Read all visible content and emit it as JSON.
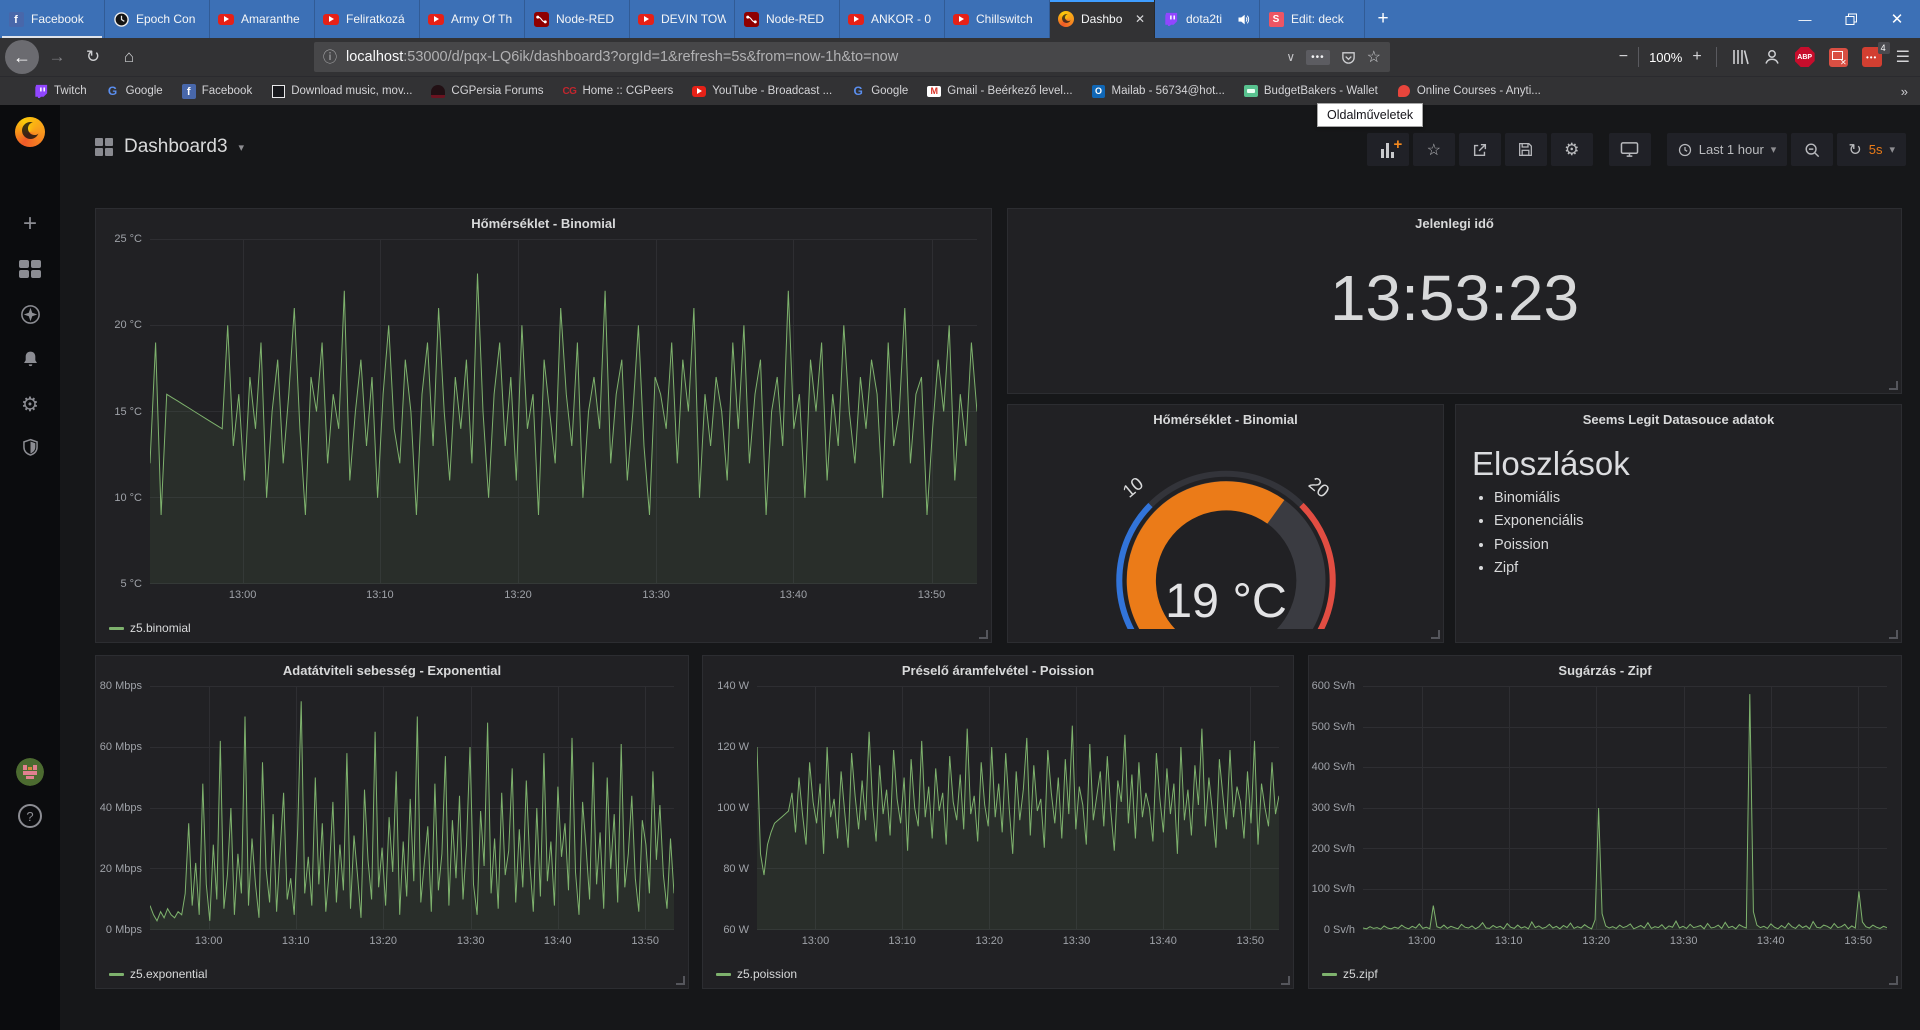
{
  "browser": {
    "tabs": [
      {
        "id": "facebook",
        "label": "Facebook",
        "icon": "facebook",
        "container": true
      },
      {
        "id": "epoch-converter",
        "label": "Epoch Con",
        "icon": "clock"
      },
      {
        "id": "amaranthe",
        "label": "Amaranthe",
        "icon": "youtube"
      },
      {
        "id": "feliratkozas",
        "label": "Feliratkozá",
        "icon": "youtube"
      },
      {
        "id": "army-of-the",
        "label": "Army Of Th",
        "icon": "youtube"
      },
      {
        "id": "node-red-1",
        "label": "Node-RED",
        "icon": "nodered"
      },
      {
        "id": "devin-townsend",
        "label": "DEVIN TOW",
        "icon": "youtube"
      },
      {
        "id": "node-red-2",
        "label": "Node-RED",
        "icon": "nodered"
      },
      {
        "id": "ankor",
        "label": "ANKOR - 0",
        "icon": "youtube"
      },
      {
        "id": "chillswitch",
        "label": "Chillswitch",
        "icon": "youtube"
      },
      {
        "id": "dashboard",
        "label": "Dashbo",
        "icon": "grafana",
        "active": true,
        "close": "✕"
      },
      {
        "id": "dota2ti",
        "label": "dota2ti",
        "icon": "twitch",
        "audio": true
      },
      {
        "id": "edit-deck",
        "label": "Edit: deck",
        "icon": "slides"
      }
    ],
    "new_tab_label": "+",
    "window_controls": {
      "minimize": "—",
      "close": "✕"
    },
    "nav": {
      "url_host": "localhost",
      "url_rest": ":53000/d/pqx-LQ6ik/dashboard3?orgId=1&refresh=5s&from=now-1h&to=now",
      "page_actions_glyph": "•••",
      "zoom_level": "100%",
      "extension_badge_count": "4",
      "abp_label": "ABP"
    },
    "bookmarks": [
      {
        "label": "Twitch",
        "icon": "twitch"
      },
      {
        "label": "Google",
        "icon": "google"
      },
      {
        "label": "Facebook",
        "icon": "facebook"
      },
      {
        "label": "Download music, mov...",
        "icon": "archive"
      },
      {
        "label": "CGPersia Forums",
        "icon": "cgpersia"
      },
      {
        "label": "Home :: CGPeers",
        "icon": "cgpeers"
      },
      {
        "label": "YouTube - Broadcast ...",
        "icon": "youtube"
      },
      {
        "label": "Google",
        "icon": "google"
      },
      {
        "label": "Gmail - Beérkező level...",
        "icon": "gmail"
      },
      {
        "label": "Mailab - 56734@hot...",
        "icon": "outlook"
      },
      {
        "label": "BudgetBakers - Wallet",
        "icon": "budgetbakers"
      },
      {
        "label": "Online Courses - Anyti...",
        "icon": "courses"
      }
    ],
    "bookmarks_overflow": "»",
    "tooltip": "Oldalműveletek"
  },
  "grafana": {
    "toolbar": {
      "title": "Dashboard3",
      "time_range": "Last 1 hour",
      "refresh_interval": "5s"
    },
    "clock_panel": {
      "title": "Jelenlegi idő",
      "time": "13:53:23"
    },
    "text_panel": {
      "title": "Seems Legit Datasouce adatok",
      "heading": "Eloszlások",
      "items": [
        "Binomiális",
        "Exponenciális",
        "Poission",
        "Zipf"
      ]
    }
  },
  "chart_data": [
    {
      "type": "line",
      "title": "Hőmérséklet - Binomial",
      "series_label": "z5.binomial",
      "color": "#7eb26d",
      "ylim": [
        5,
        25
      ],
      "yticks": [
        "25 °C",
        "20 °C",
        "15 °C",
        "10 °C",
        "5 °C"
      ],
      "xticks": [
        "13:00",
        "13:10",
        "13:20",
        "13:30",
        "13:40",
        "13:50"
      ],
      "xtick_fracs": [
        0.112,
        0.278,
        0.445,
        0.612,
        0.778,
        0.945
      ],
      "values": [
        12,
        19,
        9,
        16,
        15.8,
        15.6,
        15.4,
        15.2,
        15,
        14.8,
        14.6,
        14.4,
        14.2,
        14,
        20,
        13,
        16,
        11,
        17,
        14,
        19,
        10,
        15,
        18,
        12,
        16,
        21,
        14,
        9,
        17,
        15,
        19,
        12,
        16,
        14,
        22,
        11,
        15,
        18,
        13,
        17,
        10,
        16,
        20,
        14,
        12,
        18,
        15,
        9,
        16,
        19,
        13,
        21,
        15,
        11,
        17,
        14,
        18,
        12,
        23,
        15,
        10,
        16,
        19,
        13,
        17,
        11,
        20,
        14,
        16,
        9,
        18,
        15,
        12,
        21,
        16,
        13,
        19,
        10,
        15,
        17,
        14,
        22,
        12,
        16,
        18,
        11,
        15,
        20,
        13,
        9,
        17,
        16,
        14,
        19,
        12,
        18,
        15,
        21,
        10,
        16,
        13,
        17,
        15,
        11,
        19,
        14,
        20,
        12,
        16,
        18,
        9,
        15,
        17,
        13,
        22,
        14,
        16,
        10,
        18,
        15,
        19,
        11,
        16,
        13,
        20,
        15,
        12,
        17,
        14,
        18,
        16,
        10,
        19,
        13,
        15,
        21,
        12,
        16,
        17,
        9,
        14,
        18,
        15,
        20,
        11,
        16,
        13,
        19,
        15
      ]
    },
    {
      "type": "line",
      "title": "Adatátviteli sebesség - Exponential",
      "series_label": "z5.exponential",
      "color": "#7eb26d",
      "ylim": [
        0,
        80
      ],
      "yticks": [
        "80 Mbps",
        "60 Mbps",
        "40 Mbps",
        "20 Mbps",
        "0 Mbps"
      ],
      "xticks": [
        "13:00",
        "13:10",
        "13:20",
        "13:30",
        "13:40",
        "13:50"
      ],
      "xtick_fracs": [
        0.112,
        0.278,
        0.445,
        0.612,
        0.778,
        0.945
      ],
      "values": [
        8,
        5,
        3,
        6,
        4,
        7,
        5,
        4,
        6,
        5,
        12,
        35,
        8,
        22,
        5,
        48,
        15,
        3,
        28,
        10,
        62,
        7,
        18,
        40,
        5,
        25,
        12,
        70,
        8,
        30,
        15,
        4,
        55,
        20,
        9,
        38,
        6,
        26,
        45,
        10,
        17,
        5,
        33,
        75,
        12,
        24,
        8,
        50,
        15,
        35,
        6,
        20,
        42,
        9,
        28,
        13,
        58,
        7,
        31,
        18,
        4,
        46,
        23,
        10,
        65,
        14,
        27,
        8,
        37,
        19,
        52,
        5,
        29,
        11,
        43,
        16,
        70,
        9,
        22,
        34,
        6,
        48,
        13,
        25,
        57,
        8,
        36,
        17,
        44,
        10,
        28,
        60,
        15,
        5,
        39,
        21,
        68,
        12,
        30,
        7,
        45,
        18,
        26,
        53,
        9,
        33,
        14,
        49,
        22,
        6,
        40,
        11,
        58,
        16,
        29,
        8,
        47,
        24,
        35,
        13,
        63,
        19,
        5,
        42,
        27,
        10,
        55,
        15,
        32,
        7,
        50,
        20,
        38,
        9,
        61,
        14,
        25,
        44,
        17,
        6,
        36,
        28,
        12,
        52,
        23,
        41,
        18,
        7,
        30,
        12
      ]
    },
    {
      "type": "line",
      "title": "Préselő áramfelvétel - Poission",
      "series_label": "z5.poission",
      "color": "#7eb26d",
      "ylim": [
        60,
        140
      ],
      "yticks": [
        "140 W",
        "120 W",
        "100 W",
        "80 W",
        "60 W"
      ],
      "xticks": [
        "13:00",
        "13:10",
        "13:20",
        "13:30",
        "13:40",
        "13:50"
      ],
      "xtick_fracs": [
        0.112,
        0.278,
        0.445,
        0.612,
        0.778,
        0.945
      ],
      "values": [
        120,
        85,
        78,
        88,
        92,
        95,
        96,
        97,
        98,
        99,
        105,
        92,
        110,
        98,
        88,
        115,
        102,
        95,
        108,
        85,
        120,
        97,
        103,
        90,
        112,
        99,
        87,
        118,
        104,
        93,
        109,
        96,
        125,
        101,
        89,
        114,
        98,
        106,
        91,
        119,
        103,
        95,
        110,
        86,
        116,
        100,
        94,
        122,
        97,
        107,
        90,
        113,
        99,
        105,
        88,
        117,
        102,
        96,
        111,
        93,
        126,
        98,
        104,
        89,
        115,
        101,
        94,
        120,
        97,
        108,
        92,
        118,
        100,
        85,
        112,
        96,
        106,
        123,
        91,
        114,
        99,
        103,
        87,
        119,
        105,
        95,
        110,
        90,
        116,
        98,
        127,
        93,
        107,
        101,
        88,
        121,
        96,
        104,
        112,
        94,
        117,
        99,
        86,
        109,
        102,
        124,
        95,
        111,
        90,
        115,
        97,
        105,
        100,
        89,
        118,
        103,
        92,
        113,
        98,
        108,
        85,
        120,
        96,
        106,
        91,
        114,
        101,
        126,
        94,
        110,
        99,
        87,
        116,
        104,
        93,
        119,
        97,
        107,
        102,
        90,
        112,
        95,
        122,
        88,
        108,
        100,
        94,
        115,
        98,
        104
      ]
    },
    {
      "type": "line",
      "title": "Sugárzás - Zipf",
      "series_label": "z5.zipf",
      "color": "#7eb26d",
      "ylim": [
        0,
        600
      ],
      "yticks": [
        "600 Sv/h",
        "500 Sv/h",
        "400 Sv/h",
        "300 Sv/h",
        "200 Sv/h",
        "100 Sv/h",
        "0 Sv/h"
      ],
      "xticks": [
        "13:00",
        "13:10",
        "13:20",
        "13:30",
        "13:40",
        "13:50"
      ],
      "xtick_fracs": [
        0.112,
        0.278,
        0.445,
        0.612,
        0.778,
        0.945
      ],
      "values": [
        5,
        3,
        8,
        4,
        6,
        2,
        10,
        5,
        3,
        7,
        4,
        12,
        6,
        3,
        9,
        5,
        15,
        4,
        7,
        3,
        60,
        8,
        5,
        12,
        4,
        9,
        6,
        3,
        14,
        7,
        5,
        10,
        3,
        8,
        18,
        5,
        4,
        11,
        6,
        9,
        3,
        16,
        7,
        4,
        12,
        5,
        8,
        3,
        20,
        6,
        10,
        4,
        7,
        14,
        5,
        9,
        3,
        11,
        6,
        17,
        4,
        8,
        5,
        13,
        7,
        3,
        25,
        300,
        40,
        10,
        5,
        8,
        4,
        12,
        6,
        9,
        15,
        3,
        7,
        11,
        5,
        18,
        4,
        8,
        6,
        13,
        3,
        10,
        7,
        22,
        5,
        9,
        4,
        14,
        6,
        8,
        11,
        3,
        16,
        5,
        7,
        12,
        4,
        19,
        6,
        9,
        3,
        13,
        8,
        5,
        580,
        45,
        12,
        6,
        9,
        4,
        15,
        7,
        3,
        11,
        5,
        17,
        8,
        4,
        13,
        6,
        10,
        3,
        21,
        7,
        5,
        12,
        9,
        4,
        16,
        6,
        8,
        14,
        3,
        10,
        5,
        95,
        20,
        8,
        5,
        12,
        7,
        4,
        9,
        6
      ]
    },
    {
      "type": "gauge",
      "title": "Hőmérséklet - Binomial",
      "value": 19,
      "display": "19 °C",
      "min": 0,
      "max": 30,
      "ticks": [
        "0",
        "10",
        "20",
        "30"
      ],
      "value_color": "#eb7b18",
      "threshold_colors": [
        "#3274d9",
        "#33343a",
        "#e24d42"
      ]
    }
  ],
  "icons": {
    "back": "←",
    "forward": "→",
    "reload": "↻",
    "home": "⌂",
    "info": "ⓘ",
    "chevron_down": "∨",
    "star": "☆",
    "minus": "−",
    "plus": "+",
    "menu": "☰",
    "caret": "▾",
    "question": "?",
    "gear": "⚙",
    "refresh": "↻"
  },
  "colors": {
    "series_green": "#7eb26d",
    "accent_orange": "#eb7b18",
    "gauge_blue": "#3274d9",
    "gauge_red": "#e24d42",
    "firefox_blue": "#3c70b6"
  }
}
